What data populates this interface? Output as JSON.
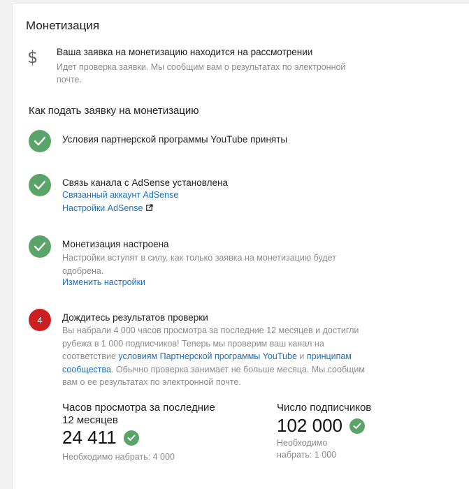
{
  "page": {
    "title": "Монетизация",
    "status": {
      "icon": "dollar-icon",
      "title": "Ваша заявка на монетизацию находится на рассмотрении",
      "description": "Идет проверка заявки. Мы сообщим вам о результатах по электронной почте."
    },
    "section_title": "Как подать заявку на монетизацию",
    "steps": [
      {
        "icon": "check-icon",
        "title": "Условия партнерской программы YouTube приняты"
      },
      {
        "icon": "check-icon",
        "title": "Связь канала с AdSense установлена",
        "link1": "Связанный аккаунт AdSense",
        "link2": "Настройки AdSense",
        "link2_icon": "external-link-icon"
      },
      {
        "icon": "check-icon",
        "title": "Монетизация настроена",
        "description": "Настройки вступят в силу, как только заявка на монетизацию будет одобрена.",
        "link": "Изменить настройки"
      },
      {
        "number": "4",
        "title": "Дождитесь результатов проверки",
        "desc_part1": "Вы набрали 4 000 часов просмотра за последние 12 месяцев и достигли рубежа в 1 000 подписчиков! Теперь мы проверим ваш канал на соответствие ",
        "link_terms": "условиям Партнерской программы YouTube",
        "desc_and": " и ",
        "link_guidelines": "принципам сообщества",
        "desc_part2": ". Обычно проверка занимает не больше месяца. Мы сообщим вам о ее результатах по электронной почте."
      }
    ],
    "stats": {
      "watch_hours": {
        "label_line1": "Часов просмотра за последние",
        "label_line2": "12 месяцев",
        "value": "24 411",
        "note": "Необходимо набрать: 4 000"
      },
      "subscribers": {
        "label": "Число подписчиков",
        "value": "102 000",
        "note_line1": "Необходимо",
        "note_line2": "набрать: 1 000"
      }
    },
    "colors": {
      "check_green": "#5aa469",
      "step_red": "#cc1f1f",
      "link_blue": "#1d70c2"
    }
  }
}
